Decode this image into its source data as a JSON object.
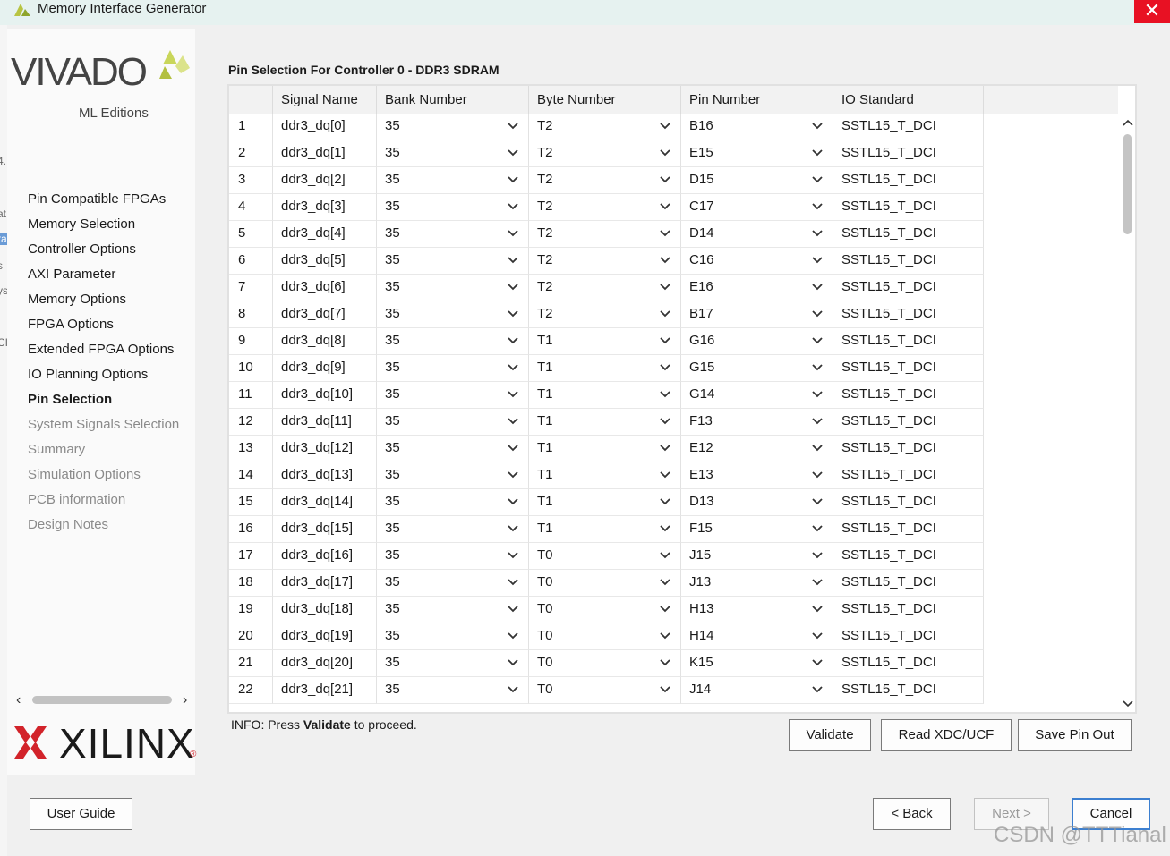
{
  "window": {
    "title": "Memory Interface Generator",
    "close_glyph": "✕"
  },
  "background_window_fragments": [
    "4.",
    "at",
    "ra",
    "s",
    "ys",
    "CI"
  ],
  "branding": {
    "vivado_word": "VIVADO",
    "vivado_sub": "ML Editions",
    "xilinx_word": "XILINX",
    "xilinx_mark": "®",
    "vivado_accent": "#c9d65a",
    "xilinx_red": "#d2232a"
  },
  "nav": {
    "items": [
      {
        "label": "Pin Compatible FPGAs",
        "state": "done"
      },
      {
        "label": "Memory Selection",
        "state": "done"
      },
      {
        "label": "Controller Options",
        "state": "done"
      },
      {
        "label": "AXI Parameter",
        "state": "done"
      },
      {
        "label": "Memory Options",
        "state": "done"
      },
      {
        "label": "FPGA Options",
        "state": "done"
      },
      {
        "label": "Extended FPGA Options",
        "state": "done"
      },
      {
        "label": "IO Planning Options",
        "state": "done"
      },
      {
        "label": "Pin Selection",
        "state": "current"
      },
      {
        "label": "System Signals Selection",
        "state": "todo"
      },
      {
        "label": "Summary",
        "state": "todo"
      },
      {
        "label": "Simulation Options",
        "state": "todo"
      },
      {
        "label": "PCB information",
        "state": "todo"
      },
      {
        "label": "Design Notes",
        "state": "todo"
      }
    ],
    "scroll_left": "‹",
    "scroll_right": "›"
  },
  "main": {
    "heading": "Pin Selection For Controller 0 - DDR3 SDRAM",
    "table": {
      "columns": [
        "",
        "Signal Name",
        "Bank Number",
        "Byte Number",
        "Pin Number",
        "IO Standard"
      ],
      "rows": [
        [
          "1",
          "ddr3_dq[0]",
          "35",
          "T2",
          "B16",
          "SSTL15_T_DCI"
        ],
        [
          "2",
          "ddr3_dq[1]",
          "35",
          "T2",
          "E15",
          "SSTL15_T_DCI"
        ],
        [
          "3",
          "ddr3_dq[2]",
          "35",
          "T2",
          "D15",
          "SSTL15_T_DCI"
        ],
        [
          "4",
          "ddr3_dq[3]",
          "35",
          "T2",
          "C17",
          "SSTL15_T_DCI"
        ],
        [
          "5",
          "ddr3_dq[4]",
          "35",
          "T2",
          "D14",
          "SSTL15_T_DCI"
        ],
        [
          "6",
          "ddr3_dq[5]",
          "35",
          "T2",
          "C16",
          "SSTL15_T_DCI"
        ],
        [
          "7",
          "ddr3_dq[6]",
          "35",
          "T2",
          "E16",
          "SSTL15_T_DCI"
        ],
        [
          "8",
          "ddr3_dq[7]",
          "35",
          "T2",
          "B17",
          "SSTL15_T_DCI"
        ],
        [
          "9",
          "ddr3_dq[8]",
          "35",
          "T1",
          "G16",
          "SSTL15_T_DCI"
        ],
        [
          "10",
          "ddr3_dq[9]",
          "35",
          "T1",
          "G15",
          "SSTL15_T_DCI"
        ],
        [
          "11",
          "ddr3_dq[10]",
          "35",
          "T1",
          "G14",
          "SSTL15_T_DCI"
        ],
        [
          "12",
          "ddr3_dq[11]",
          "35",
          "T1",
          "F13",
          "SSTL15_T_DCI"
        ],
        [
          "13",
          "ddr3_dq[12]",
          "35",
          "T1",
          "E12",
          "SSTL15_T_DCI"
        ],
        [
          "14",
          "ddr3_dq[13]",
          "35",
          "T1",
          "E13",
          "SSTL15_T_DCI"
        ],
        [
          "15",
          "ddr3_dq[14]",
          "35",
          "T1",
          "D13",
          "SSTL15_T_DCI"
        ],
        [
          "16",
          "ddr3_dq[15]",
          "35",
          "T1",
          "F15",
          "SSTL15_T_DCI"
        ],
        [
          "17",
          "ddr3_dq[16]",
          "35",
          "T0",
          "J15",
          "SSTL15_T_DCI"
        ],
        [
          "18",
          "ddr3_dq[17]",
          "35",
          "T0",
          "J13",
          "SSTL15_T_DCI"
        ],
        [
          "19",
          "ddr3_dq[18]",
          "35",
          "T0",
          "H13",
          "SSTL15_T_DCI"
        ],
        [
          "20",
          "ddr3_dq[19]",
          "35",
          "T0",
          "H14",
          "SSTL15_T_DCI"
        ],
        [
          "21",
          "ddr3_dq[20]",
          "35",
          "T0",
          "K15",
          "SSTL15_T_DCI"
        ],
        [
          "22",
          "ddr3_dq[21]",
          "35",
          "T0",
          "J14",
          "SSTL15_T_DCI"
        ]
      ]
    },
    "info_prefix": "INFO: Press ",
    "info_bold": "Validate",
    "info_suffix": " to proceed.",
    "buttons": {
      "validate": "Validate",
      "read_xdc": "Read XDC/UCF",
      "save_pin_out": "Save Pin Out"
    }
  },
  "footer": {
    "user_guide": "User Guide",
    "back": "< Back",
    "next": "Next >",
    "cancel": "Cancel"
  },
  "watermark": "CSDN @TTTianal"
}
